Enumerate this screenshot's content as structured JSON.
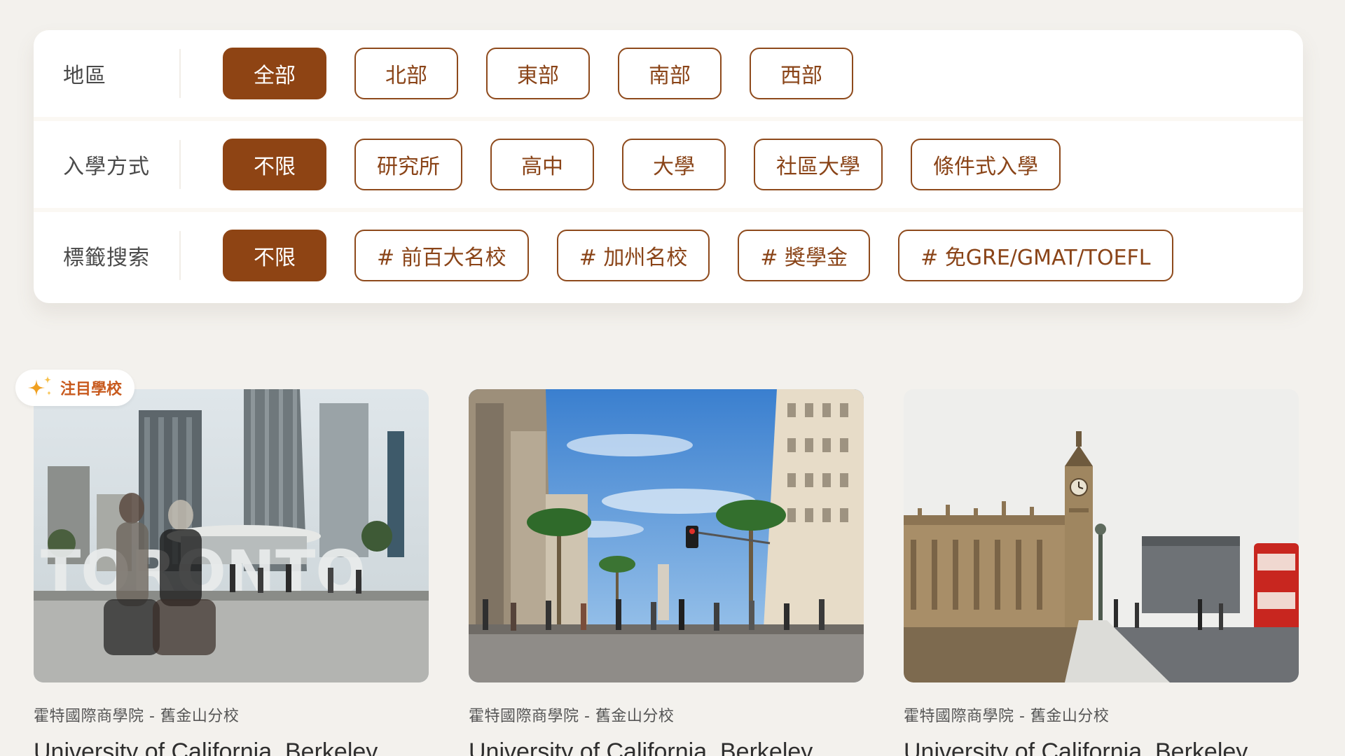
{
  "filters": {
    "region": {
      "label": "地區",
      "options": [
        "全部",
        "北部",
        "東部",
        "南部",
        "西部"
      ],
      "selected": "全部"
    },
    "admission": {
      "label": "入學方式",
      "options": [
        "不限",
        "研究所",
        "高中",
        "大學",
        "社區大學",
        "條件式入學"
      ],
      "selected": "不限"
    },
    "tags": {
      "label": "標籤搜索",
      "options": [
        "不限",
        "# 前百大名校",
        "# 加州名校",
        "# 獎學金",
        "# 免GRE/GMAT/TOEFL"
      ],
      "selected": "不限"
    }
  },
  "featured_badge": {
    "label": "注目學校",
    "icon": "sparkle-icon",
    "color": "#c85a1e"
  },
  "cards": [
    {
      "subtitle": "霍特國際商學院 - 舊金山分校",
      "title": "University of California, Berkeley",
      "image": "toronto-city-hall-photo"
    },
    {
      "subtitle": "霍特國際商學院 - 舊金山分校",
      "title": "University of California, Berkeley",
      "image": "los-angeles-street-photo"
    },
    {
      "subtitle": "霍特國際商學院 - 舊金山分校",
      "title": "University of California, Berkeley",
      "image": "london-big-ben-photo"
    }
  ],
  "colors": {
    "accent": "#8e4414",
    "background": "#f3f1ed"
  }
}
